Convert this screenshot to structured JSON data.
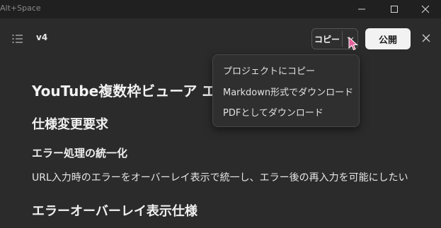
{
  "window": {
    "title": "Alt+Space"
  },
  "toolbar": {
    "version": "v4",
    "copy_label": "コピー",
    "publish_label": "公開"
  },
  "menu": {
    "items": [
      {
        "label": "プロジェクトにコピー"
      },
      {
        "label": "Markdown形式でダウンロード"
      },
      {
        "label": "PDFとしてダウンロード"
      }
    ]
  },
  "document": {
    "title": "YouTube複数枠ビューア エ",
    "h2_spec": "仕様変更要求",
    "h3_error": "エラー処理の統一化",
    "paragraph": "URL入力時のエラーをオーバーレイ表示で統一し、エラー後の再入力を可能にしたい",
    "h2_overlay": "エラーオーバーレイ表示仕様"
  },
  "colors": {
    "background": "#2b2b2b",
    "titlebar": "#202020",
    "publish_button": "#f2f2f2",
    "cursor": "#e5609a"
  },
  "icons": [
    "list-icon",
    "chevron-down-icon",
    "close-icon",
    "minimize-icon",
    "maximize-icon",
    "cursor-icon"
  ]
}
